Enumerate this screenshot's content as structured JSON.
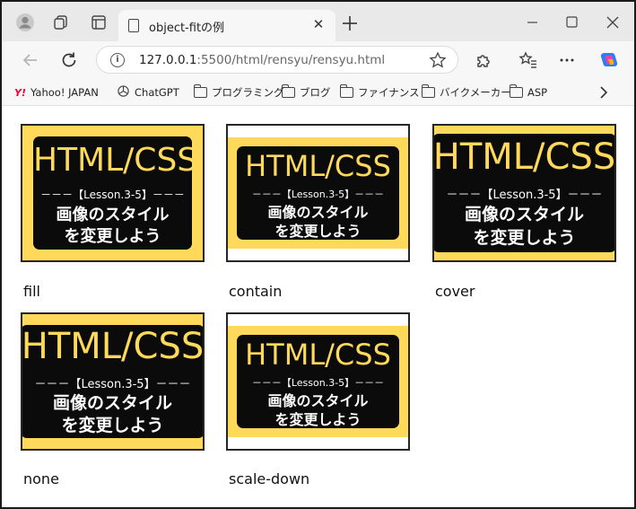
{
  "browser": {
    "tab_title": "object-fitの例",
    "tab_close": "✕",
    "url_host": "127.0.0.1",
    "url_rest": ":5500/html/rensyu/rensyu.html"
  },
  "bookmarks": [
    {
      "label": "Yahoo! JAPAN",
      "icon": "yahoo-icon"
    },
    {
      "label": "ChatGPT",
      "icon": "chatgpt-icon"
    },
    {
      "label": "プログラミング",
      "icon": "folder-icon"
    },
    {
      "label": "ブログ",
      "icon": "folder-icon"
    },
    {
      "label": "ファイナンス",
      "icon": "folder-icon"
    },
    {
      "label": "バイクメーカー",
      "icon": "folder-icon"
    },
    {
      "label": "ASP",
      "icon": "folder-icon"
    }
  ],
  "image_text": {
    "title": "HTML/CSS",
    "lesson": "－－－【Lesson.3-5】－－－",
    "line1": "画像のスタイル",
    "line2": "を変更しよう"
  },
  "demos": [
    {
      "caption": "fill"
    },
    {
      "caption": "contain"
    },
    {
      "caption": "cover"
    },
    {
      "caption": "none"
    },
    {
      "caption": "scale-down"
    }
  ],
  "colors": {
    "image_yellow": "#ffd95a",
    "image_black": "#0b0b0b"
  }
}
